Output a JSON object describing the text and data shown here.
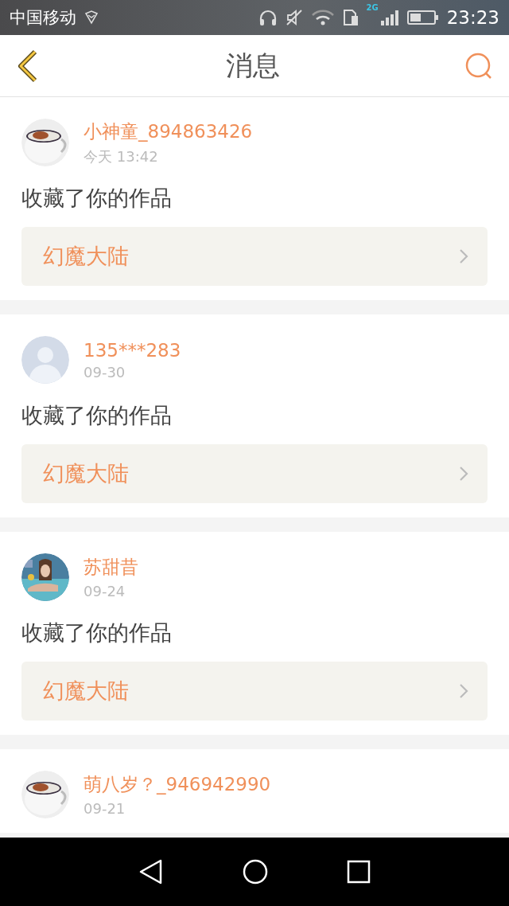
{
  "status_bar": {
    "carrier": "中国移动",
    "network": "2G",
    "time": "23:23"
  },
  "header": {
    "title": "消息"
  },
  "messages": [
    {
      "user": "小神童_894863426",
      "time": "今天 13:42",
      "text": "收藏了你的作品",
      "work": "幻魔大陆"
    },
    {
      "user": "135***283",
      "time": "09-30",
      "avatar": {
        "kind": "default"
      },
      "text": "收藏了你的作品",
      "work": "幻魔大陆"
    },
    {
      "user": "苏甜昔",
      "time": "09-24",
      "text": "收藏了你的作品",
      "work": "幻魔大陆"
    },
    {
      "user": "萌八岁？_946942990",
      "time": "09-21"
    }
  ]
}
